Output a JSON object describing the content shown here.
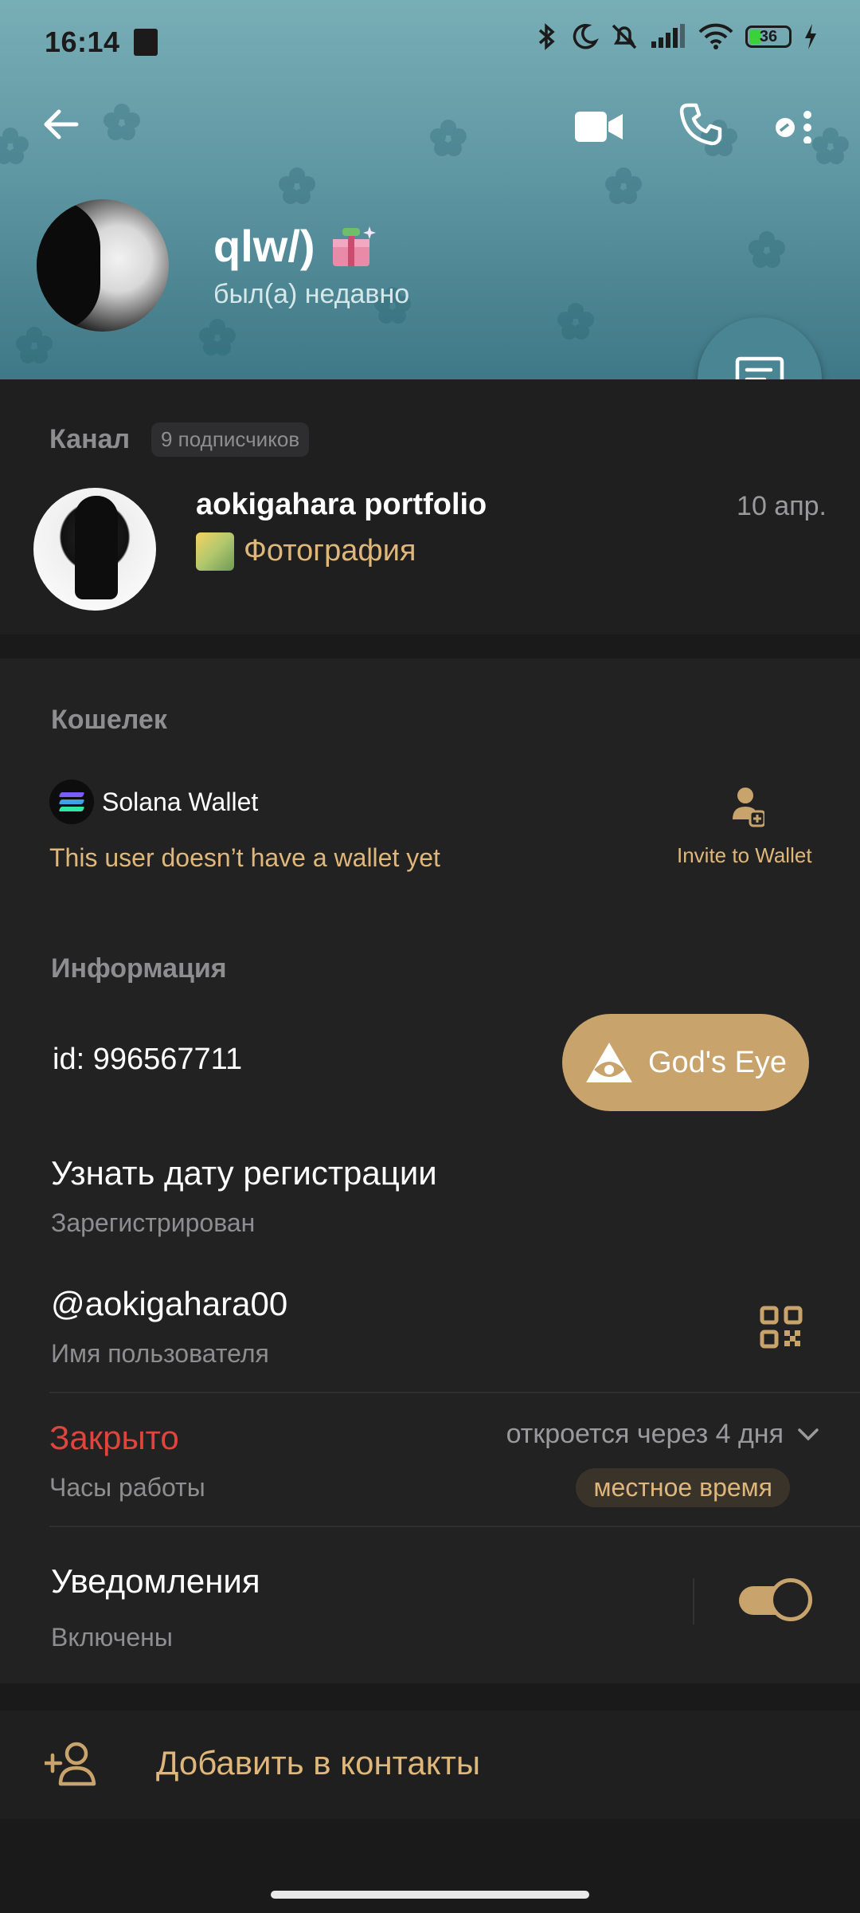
{
  "status_bar": {
    "time": "16:14",
    "battery": "36"
  },
  "header": {
    "name": "qlw/)",
    "last_seen": "был(а) недавно"
  },
  "icons": {
    "back": "back-arrow-icon",
    "video": "video-call-icon",
    "call": "phone-icon",
    "menu": "more-options-icon",
    "message": "message-icon",
    "qr": "qr-code-icon",
    "add_contact": "add-contact-icon",
    "invite": "invite-wallet-icon",
    "eye": "eye-icon"
  },
  "channel": {
    "section_label": "Канал",
    "subscribers": "9 подписчиков",
    "name": "aokigahara portfolio",
    "date": "10 апр.",
    "subtitle": "Фотография"
  },
  "wallet": {
    "section_label": "Кошелек",
    "wallet_name": "Solana Wallet",
    "note": "This user doesn’t have a wallet yet",
    "invite_label": "Invite to Wallet"
  },
  "info": {
    "section_label": "Информация",
    "id": "id: 996567711",
    "gods_eye": "God's Eye",
    "registration_title": "Узнать дату регистрации",
    "registration_sub": "Зарегистрирован",
    "username": "@aokigahara00",
    "username_sub": "Имя пользователя",
    "hours_status": "Закрыто",
    "hours_sub": "Часы работы",
    "opens": "откроется через 4 дня",
    "local_time": "местное время",
    "notifications_title": "Уведомления",
    "notifications_sub": "Включены",
    "notifications_on": true
  },
  "actions": {
    "add_contact": "Добавить в контакты"
  },
  "colors": {
    "accent": "#c9a36c",
    "accent_text": "#e0b77a",
    "closed": "#e0453d",
    "header": "#5f97a3"
  }
}
